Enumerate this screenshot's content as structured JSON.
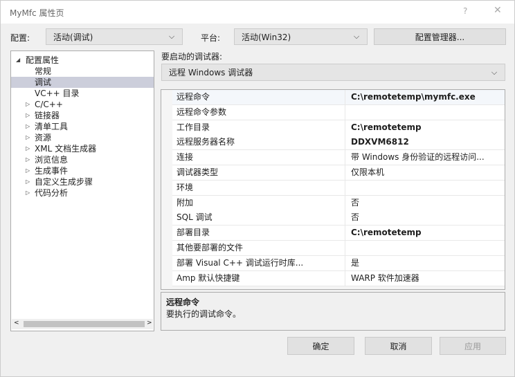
{
  "title": "MyMfc 属性页",
  "title_help": "?",
  "title_close": "✕",
  "config_label": "配置:",
  "config_value": "活动(调试)",
  "platform_label": "平台:",
  "platform_value": "活动(Win32)",
  "config_manager": "配置管理器...",
  "tree": [
    {
      "label": "配置属性",
      "expanded": true,
      "level": 0
    },
    {
      "label": "常规",
      "level": 1
    },
    {
      "label": "调试",
      "level": 1,
      "selected": true
    },
    {
      "label": "VC++ 目录",
      "level": 1
    },
    {
      "label": "C/C++",
      "level": 1,
      "collapsed": true
    },
    {
      "label": "链接器",
      "level": 1,
      "collapsed": true
    },
    {
      "label": "清单工具",
      "level": 1,
      "collapsed": true
    },
    {
      "label": "资源",
      "level": 1,
      "collapsed": true
    },
    {
      "label": "XML 文档生成器",
      "level": 1,
      "collapsed": true
    },
    {
      "label": "浏览信息",
      "level": 1,
      "collapsed": true
    },
    {
      "label": "生成事件",
      "level": 1,
      "collapsed": true
    },
    {
      "label": "自定义生成步骤",
      "level": 1,
      "collapsed": true
    },
    {
      "label": "代码分析",
      "level": 1,
      "collapsed": true
    }
  ],
  "debugger_label": "要启动的调试器:",
  "debugger_value": "远程 Windows 调试器",
  "properties": [
    {
      "name": "远程命令",
      "value": "C:\\remotetemp\\mymfc.exe",
      "bold": true
    },
    {
      "name": "远程命令参数",
      "value": ""
    },
    {
      "name": "工作目录",
      "value": "C:\\remotetemp",
      "bold": true
    },
    {
      "name": "远程服务器名称",
      "value": "DDXVM6812",
      "bold": true
    },
    {
      "name": "连接",
      "value": "带 Windows 身份验证的远程访问..."
    },
    {
      "name": "调试器类型",
      "value": "仅限本机"
    },
    {
      "name": "环境",
      "value": ""
    },
    {
      "name": "附加",
      "value": "否"
    },
    {
      "name": "SQL 调试",
      "value": "否"
    },
    {
      "name": "部署目录",
      "value": "C:\\remotetemp",
      "bold": true
    },
    {
      "name": "其他要部署的文件",
      "value": ""
    },
    {
      "name": "部署 Visual C++ 调试运行时库...",
      "value": "是"
    },
    {
      "name": "Amp 默认快捷键",
      "value": "WARP 软件加速器"
    }
  ],
  "description": {
    "title": "远程命令",
    "text": "要执行的调试命令。"
  },
  "buttons": {
    "ok": "确定",
    "cancel": "取消",
    "apply": "应用"
  }
}
